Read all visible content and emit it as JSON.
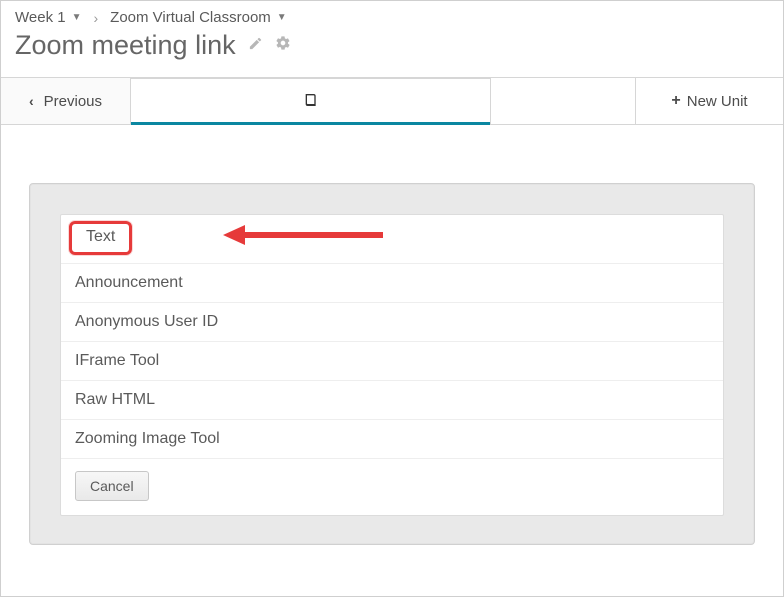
{
  "breadcrumb": {
    "item1": "Week 1",
    "item2": "Zoom Virtual Classroom"
  },
  "title": "Zoom meeting link",
  "tabs": {
    "previous": "Previous",
    "new_unit": "New Unit"
  },
  "options": {
    "text": "Text",
    "announcement": "Announcement",
    "anonymous_user_id": "Anonymous User ID",
    "iframe_tool": "IFrame Tool",
    "raw_html": "Raw HTML",
    "zooming_image_tool": "Zooming Image Tool"
  },
  "cancel": "Cancel"
}
